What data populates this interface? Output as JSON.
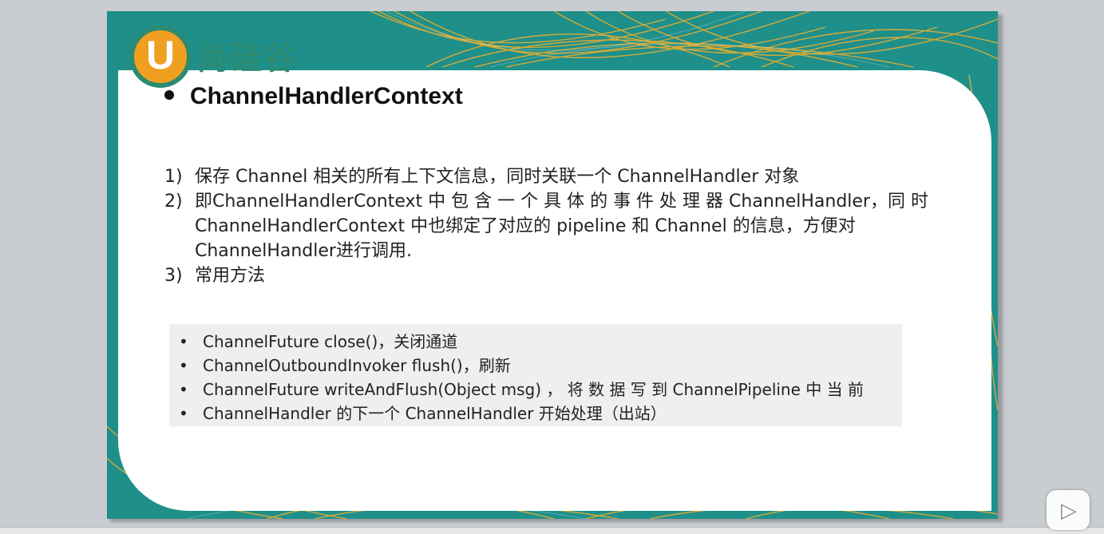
{
  "logo": {
    "mark": "U",
    "text": "尚硅谷"
  },
  "title": "ChannelHandlerContext",
  "items": [
    {
      "num": "1)",
      "text": "保存 Channel 相关的所有上下文信息，同时关联一个  ChannelHandler 对象"
    },
    {
      "num": "2)",
      "text": "即ChannelHandlerContext 中 包 含 一 个 具 体 的 事 件 处 理 器 ChannelHandler，同 时ChannelHandlerContext 中也绑定了对应的 pipeline 和 Channel 的信息，方便对 ChannelHandler进行调用."
    },
    {
      "num": "3)",
      "text": "常用方法"
    }
  ],
  "methods": [
    "ChannelFuture close()，关闭通道",
    "ChannelOutboundInvoker flush()，刷新",
    "ChannelFuture writeAndFlush(Object msg) ， 将 数 据 写 到 ChannelPipeline  中 当 前",
    "ChannelHandler  的下一个 ChannelHandler  开始处理（出站）"
  ],
  "player": {
    "icon": "play-icon"
  },
  "colors": {
    "teal": "#1f8f8a",
    "orange": "#f0a020",
    "logo_green": "#2c8a72"
  }
}
